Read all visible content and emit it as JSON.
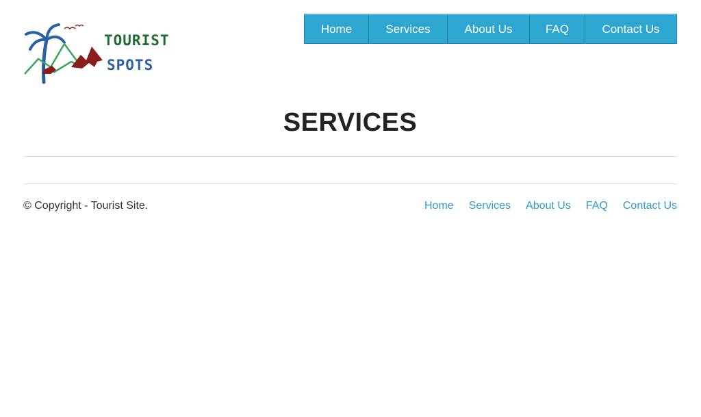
{
  "logo": {
    "line1": "TOURIST",
    "line2": "SPOTS",
    "icon": "palm-mountains-logo"
  },
  "nav": {
    "items": [
      {
        "label": "Home"
      },
      {
        "label": "Services"
      },
      {
        "label": "About Us"
      },
      {
        "label": "FAQ"
      },
      {
        "label": "Contact Us"
      }
    ]
  },
  "main": {
    "title": "SERVICES"
  },
  "footer": {
    "copyright": "© Copyright - Tourist Site.",
    "links": [
      {
        "label": "Home"
      },
      {
        "label": "Services"
      },
      {
        "label": "About Us"
      },
      {
        "label": "FAQ"
      },
      {
        "label": "Contact Us"
      }
    ]
  },
  "colors": {
    "nav_bg": "#2ea6d2",
    "link": "#2e9ccc",
    "logo_green": "#1f6b33",
    "logo_blue": "#2b5fa8",
    "logo_red": "#8b1c1c"
  }
}
